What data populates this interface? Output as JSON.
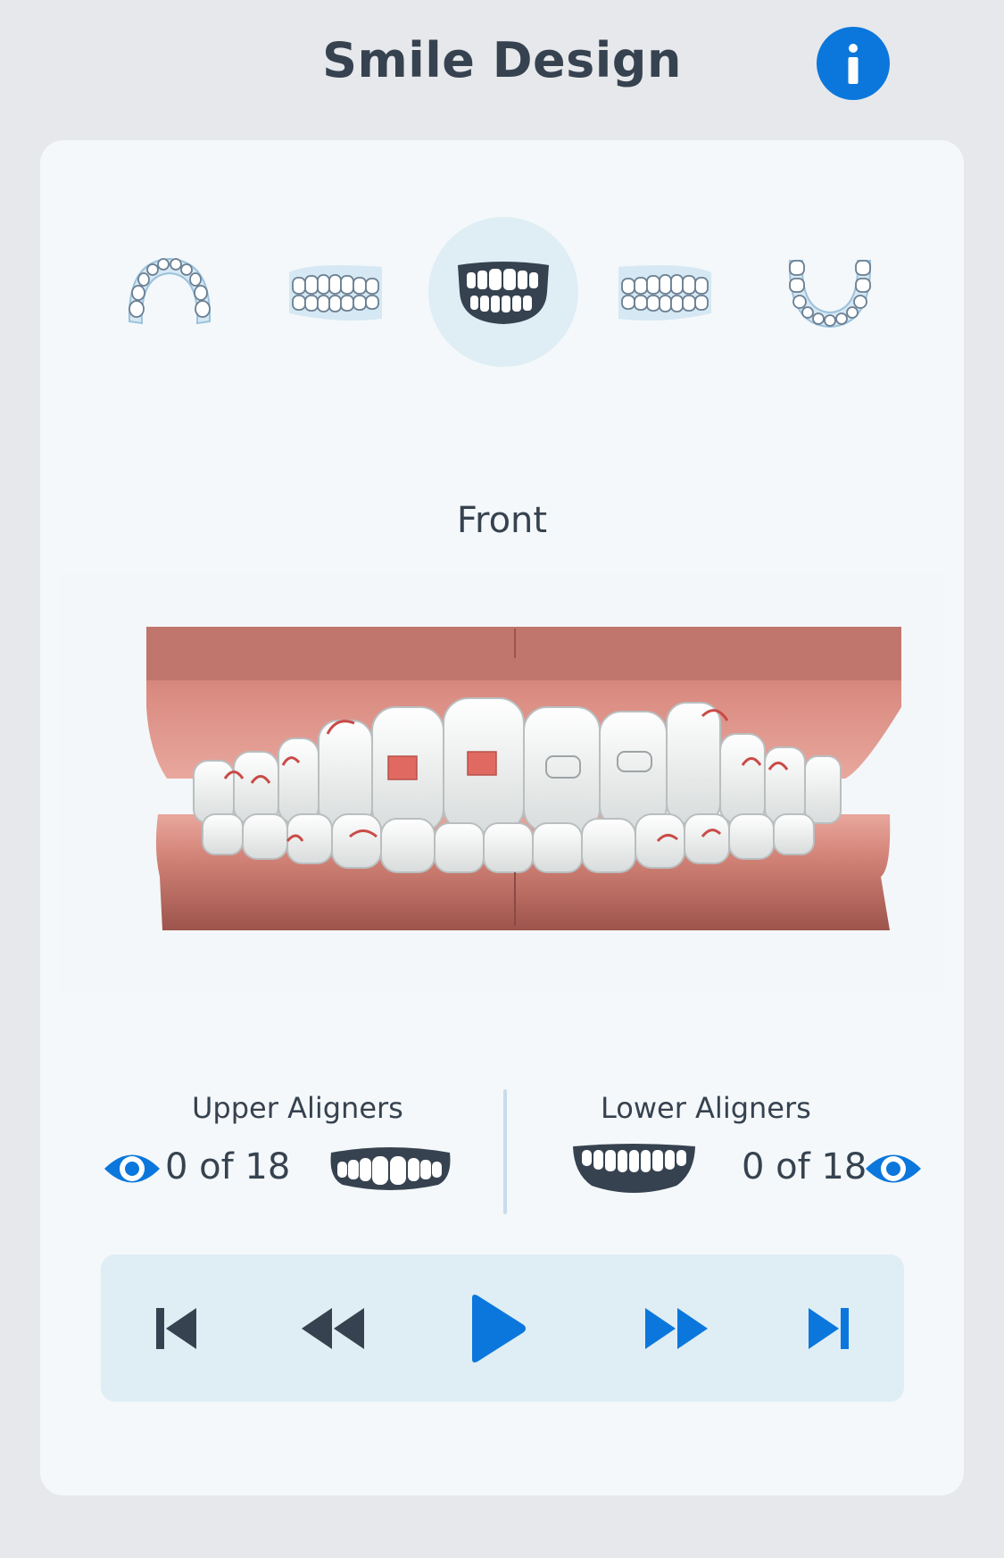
{
  "header": {
    "title": "Smile Design",
    "info_icon": "info-icon"
  },
  "views": [
    {
      "icon": "upper-arch-occlusal-icon",
      "selected": false
    },
    {
      "icon": "right-side-teeth-icon",
      "selected": false
    },
    {
      "icon": "front-teeth-icon",
      "selected": true
    },
    {
      "icon": "left-side-teeth-icon",
      "selected": false
    },
    {
      "icon": "lower-arch-occlusal-icon",
      "selected": false
    }
  ],
  "current_view": "Front",
  "aligners": {
    "upper": {
      "title": "Upper Aligners",
      "count": "0 of 18",
      "visible": true
    },
    "lower": {
      "title": "Lower Aligners",
      "count": "0 of 18",
      "visible": true
    }
  },
  "playback": {
    "buttons": [
      "skip-to-start-icon",
      "rewind-icon",
      "play-icon",
      "fast-forward-icon",
      "skip-to-end-icon"
    ]
  },
  "colors": {
    "accent": "#0b77dc",
    "dark": "#36424f",
    "gum": "#d98a80",
    "panel": "#dfedf5"
  }
}
